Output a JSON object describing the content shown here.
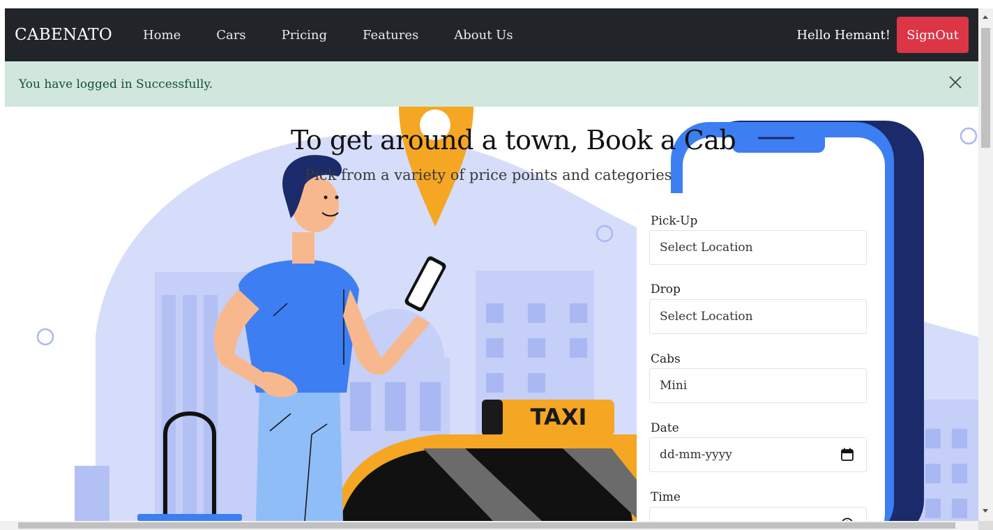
{
  "navbar": {
    "brand": "CABENATO",
    "links": [
      "Home",
      "Cars",
      "Pricing",
      "Features",
      "About Us"
    ],
    "greeting": "Hello Hemant!",
    "signout_label": "SignOut"
  },
  "alert": {
    "message": "You have logged in Successfully."
  },
  "hero": {
    "title": "To get around a town, Book a Cab",
    "subtitle": "Pick from a variety of price points and categories",
    "taxi_sign": "TAXI"
  },
  "form": {
    "pickup": {
      "label": "Pick-Up",
      "value": "Select Location"
    },
    "drop": {
      "label": "Drop",
      "value": "Select Location"
    },
    "cabs": {
      "label": "Cabs",
      "value": "Mini"
    },
    "date": {
      "label": "Date",
      "value": "dd-mm-yyyy"
    },
    "time": {
      "label": "Time",
      "value": ""
    }
  },
  "colors": {
    "navbar_bg": "#212529",
    "signout_bg": "#dc3545",
    "alert_bg": "#d1e7dd",
    "alert_text": "#0f5132",
    "accent_blue": "#3d7ef2",
    "taxi_yellow": "#f5a623"
  }
}
